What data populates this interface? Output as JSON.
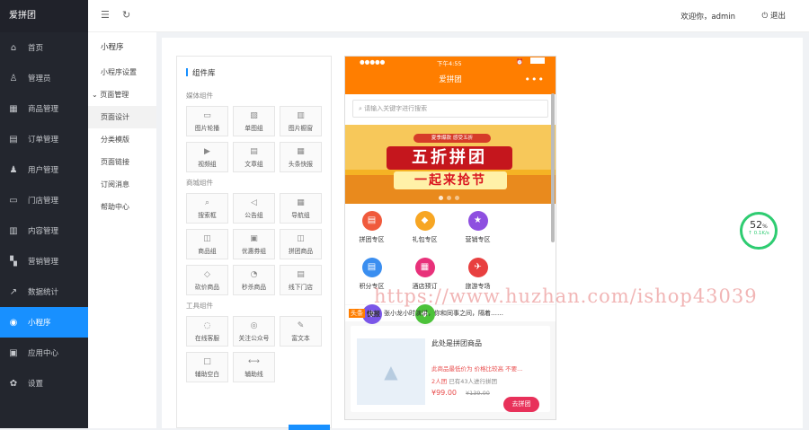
{
  "app": {
    "brand": "爱拼团"
  },
  "sidebar": {
    "items": [
      {
        "icon": "home-icon",
        "glyph": "⌂",
        "label": "首页"
      },
      {
        "icon": "admin-icon",
        "glyph": "♙",
        "label": "管理员"
      },
      {
        "icon": "goods-icon",
        "glyph": "▦",
        "label": "商品管理"
      },
      {
        "icon": "order-icon",
        "glyph": "▤",
        "label": "订单管理"
      },
      {
        "icon": "user-icon",
        "glyph": "♟",
        "label": "用户管理"
      },
      {
        "icon": "store-icon",
        "glyph": "▭",
        "label": "门店管理"
      },
      {
        "icon": "content-icon",
        "glyph": "▥",
        "label": "内容管理"
      },
      {
        "icon": "marketing-icon",
        "glyph": "▚",
        "label": "营销管理"
      },
      {
        "icon": "stats-icon",
        "glyph": "↗",
        "label": "数据统计"
      },
      {
        "icon": "miniapp-icon",
        "glyph": "◉",
        "label": "小程序"
      },
      {
        "icon": "apps-icon",
        "glyph": "▣",
        "label": "应用中心"
      },
      {
        "icon": "settings-icon",
        "glyph": "✿",
        "label": "设置"
      }
    ]
  },
  "topbar": {
    "welcome": "欢迎你，admin",
    "logout": "退出"
  },
  "subnav": {
    "title": "小程序",
    "items": [
      "小程序设置",
      "页面管理",
      "页面设计",
      "分类模版",
      "页面链接",
      "订阅消息",
      "帮助中心"
    ]
  },
  "library": {
    "title": "组件库",
    "groups": [
      {
        "name": "媒体组件",
        "items": [
          {
            "label": "图片轮播",
            "glyph": "▭"
          },
          {
            "label": "单图组",
            "glyph": "▨"
          },
          {
            "label": "图片橱窗",
            "glyph": "▥"
          },
          {
            "label": "视频组",
            "glyph": "▶"
          },
          {
            "label": "文章组",
            "glyph": "▤"
          },
          {
            "label": "头条快报",
            "glyph": "▦"
          }
        ]
      },
      {
        "name": "商城组件",
        "items": [
          {
            "label": "搜索框",
            "glyph": "⌕"
          },
          {
            "label": "公告组",
            "glyph": "◁"
          },
          {
            "label": "导航组",
            "glyph": "▦"
          },
          {
            "label": "商品组",
            "glyph": "◫"
          },
          {
            "label": "优惠券组",
            "glyph": "▣"
          },
          {
            "label": "拼团商品",
            "glyph": "◫"
          },
          {
            "label": "砍价商品",
            "glyph": "◇"
          },
          {
            "label": "秒杀商品",
            "glyph": "◔"
          },
          {
            "label": "线下门店",
            "glyph": "▤"
          }
        ]
      },
      {
        "name": "工具组件",
        "items": [
          {
            "label": "在线客服",
            "glyph": "◌"
          },
          {
            "label": "关注公众号",
            "glyph": "◎"
          },
          {
            "label": "富文本",
            "glyph": "✎"
          },
          {
            "label": "辅助空白",
            "glyph": "□"
          },
          {
            "label": "辅助线",
            "glyph": "⟷"
          }
        ]
      }
    ]
  },
  "phone": {
    "status_left": "●●●●●",
    "status_time": "下午4:55",
    "title": "爱拼团",
    "search_placeholder": "请输入关键字进行搜索",
    "banner": {
      "tag": "夏季爆款 感受五折",
      "line1": "五折拼团",
      "line2": "一起来抢节"
    },
    "categories": [
      {
        "label": "拼团专区",
        "color": "#f05a3c",
        "glyph": "▤"
      },
      {
        "label": "礼包专区",
        "color": "#f7a623",
        "glyph": "◆"
      },
      {
        "label": "营销专区",
        "color": "#8e4fe0",
        "glyph": "★"
      },
      {
        "label": "积分专区",
        "color": "#3a8ef0",
        "glyph": "▤"
      },
      {
        "label": "酒店预订",
        "color": "#e8317a",
        "glyph": "▦"
      },
      {
        "label": "旅游专场",
        "color": "#e83f3f",
        "glyph": "✈"
      },
      {
        "label": "产品供应",
        "color": "#7a56e8",
        "glyph": "◈"
      },
      {
        "label": "健康专区",
        "color": "#4cc23a",
        "glyph": "◆"
      }
    ],
    "news": {
      "tag1": "头条",
      "tag2": "快报",
      "text": "张小龙小时演讲，你和同事之间，隔着……"
    },
    "product": {
      "title": "此处是拼团商品",
      "desc": "此商品最低价为 价格比较高 不要...",
      "group": "2人团",
      "group_count": "已有43人进行拼团",
      "price": "¥99.00",
      "old_price": "¥139.00",
      "button": "去拼团"
    }
  },
  "monitor": {
    "percent": "52",
    "percent_unit": "%",
    "speed": "↑ 0.1K/s"
  },
  "watermark": "https://www.huzhan.com/ishop43039"
}
